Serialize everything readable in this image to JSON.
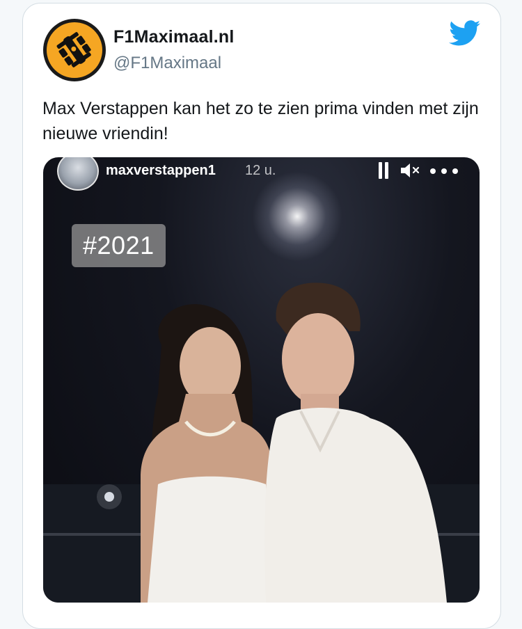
{
  "tweet": {
    "display_name": "F1Maximaal.nl",
    "handle": "@F1Maximaal",
    "text": "Max Verstappen kan het zo te zien prima vinden met zijn nieuwe vriendin!",
    "avatar_icon": "race-car-icon",
    "brand_icon": "twitter-bird-icon",
    "colors": {
      "twitter_blue": "#1da1f2",
      "avatar_orange": "#f5a623",
      "text": "#14171a",
      "secondary_text": "#657786"
    }
  },
  "story": {
    "username": "maxverstappen1",
    "time_ago": "12 u.",
    "hashtag_sticker": "#2021",
    "controls": [
      "pause-icon",
      "mute-icon",
      "more-icon"
    ]
  }
}
